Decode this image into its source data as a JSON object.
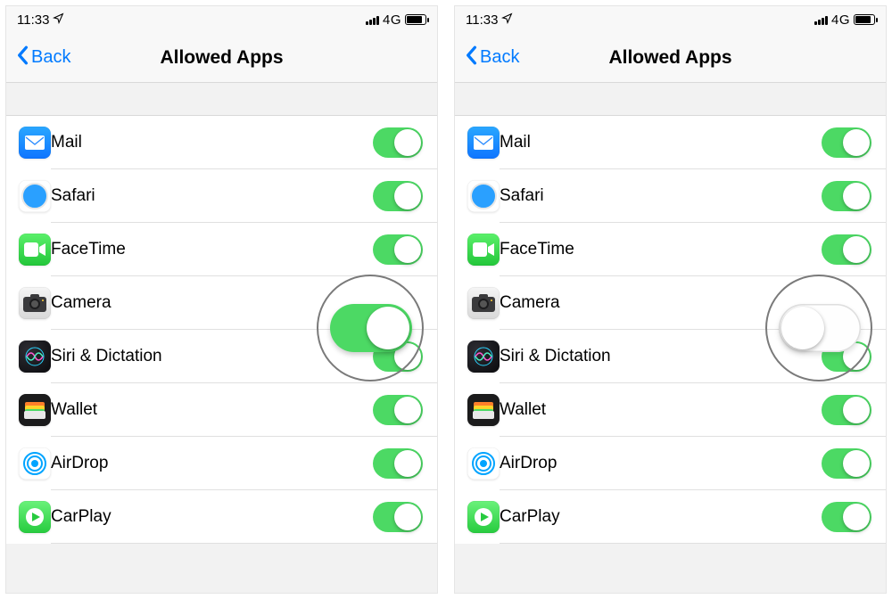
{
  "screens": [
    {
      "status": {
        "time": "11:33",
        "network": "4G"
      },
      "nav": {
        "back": "Back",
        "title": "Allowed Apps"
      },
      "apps": [
        {
          "name": "Mail",
          "icon": "mail-icon",
          "on": true
        },
        {
          "name": "Safari",
          "icon": "safari-icon",
          "on": true
        },
        {
          "name": "FaceTime",
          "icon": "facetime-icon",
          "on": true
        },
        {
          "name": "Camera",
          "icon": "camera-icon",
          "on": true
        },
        {
          "name": "Siri & Dictation",
          "icon": "siri-icon",
          "on": true
        },
        {
          "name": "Wallet",
          "icon": "wallet-icon",
          "on": true
        },
        {
          "name": "AirDrop",
          "icon": "airdrop-icon",
          "on": true
        },
        {
          "name": "CarPlay",
          "icon": "carplay-icon",
          "on": true
        }
      ],
      "highlight": {
        "index": 3,
        "toggle_on": true
      }
    },
    {
      "status": {
        "time": "11:33",
        "network": "4G"
      },
      "nav": {
        "back": "Back",
        "title": "Allowed Apps"
      },
      "apps": [
        {
          "name": "Mail",
          "icon": "mail-icon",
          "on": true
        },
        {
          "name": "Safari",
          "icon": "safari-icon",
          "on": true
        },
        {
          "name": "FaceTime",
          "icon": "facetime-icon",
          "on": true
        },
        {
          "name": "Camera",
          "icon": "camera-icon",
          "on": false
        },
        {
          "name": "Siri & Dictation",
          "icon": "siri-icon",
          "on": true
        },
        {
          "name": "Wallet",
          "icon": "wallet-icon",
          "on": true
        },
        {
          "name": "AirDrop",
          "icon": "airdrop-icon",
          "on": true
        },
        {
          "name": "CarPlay",
          "icon": "carplay-icon",
          "on": true
        }
      ],
      "highlight": {
        "index": 3,
        "toggle_on": false
      }
    }
  ]
}
